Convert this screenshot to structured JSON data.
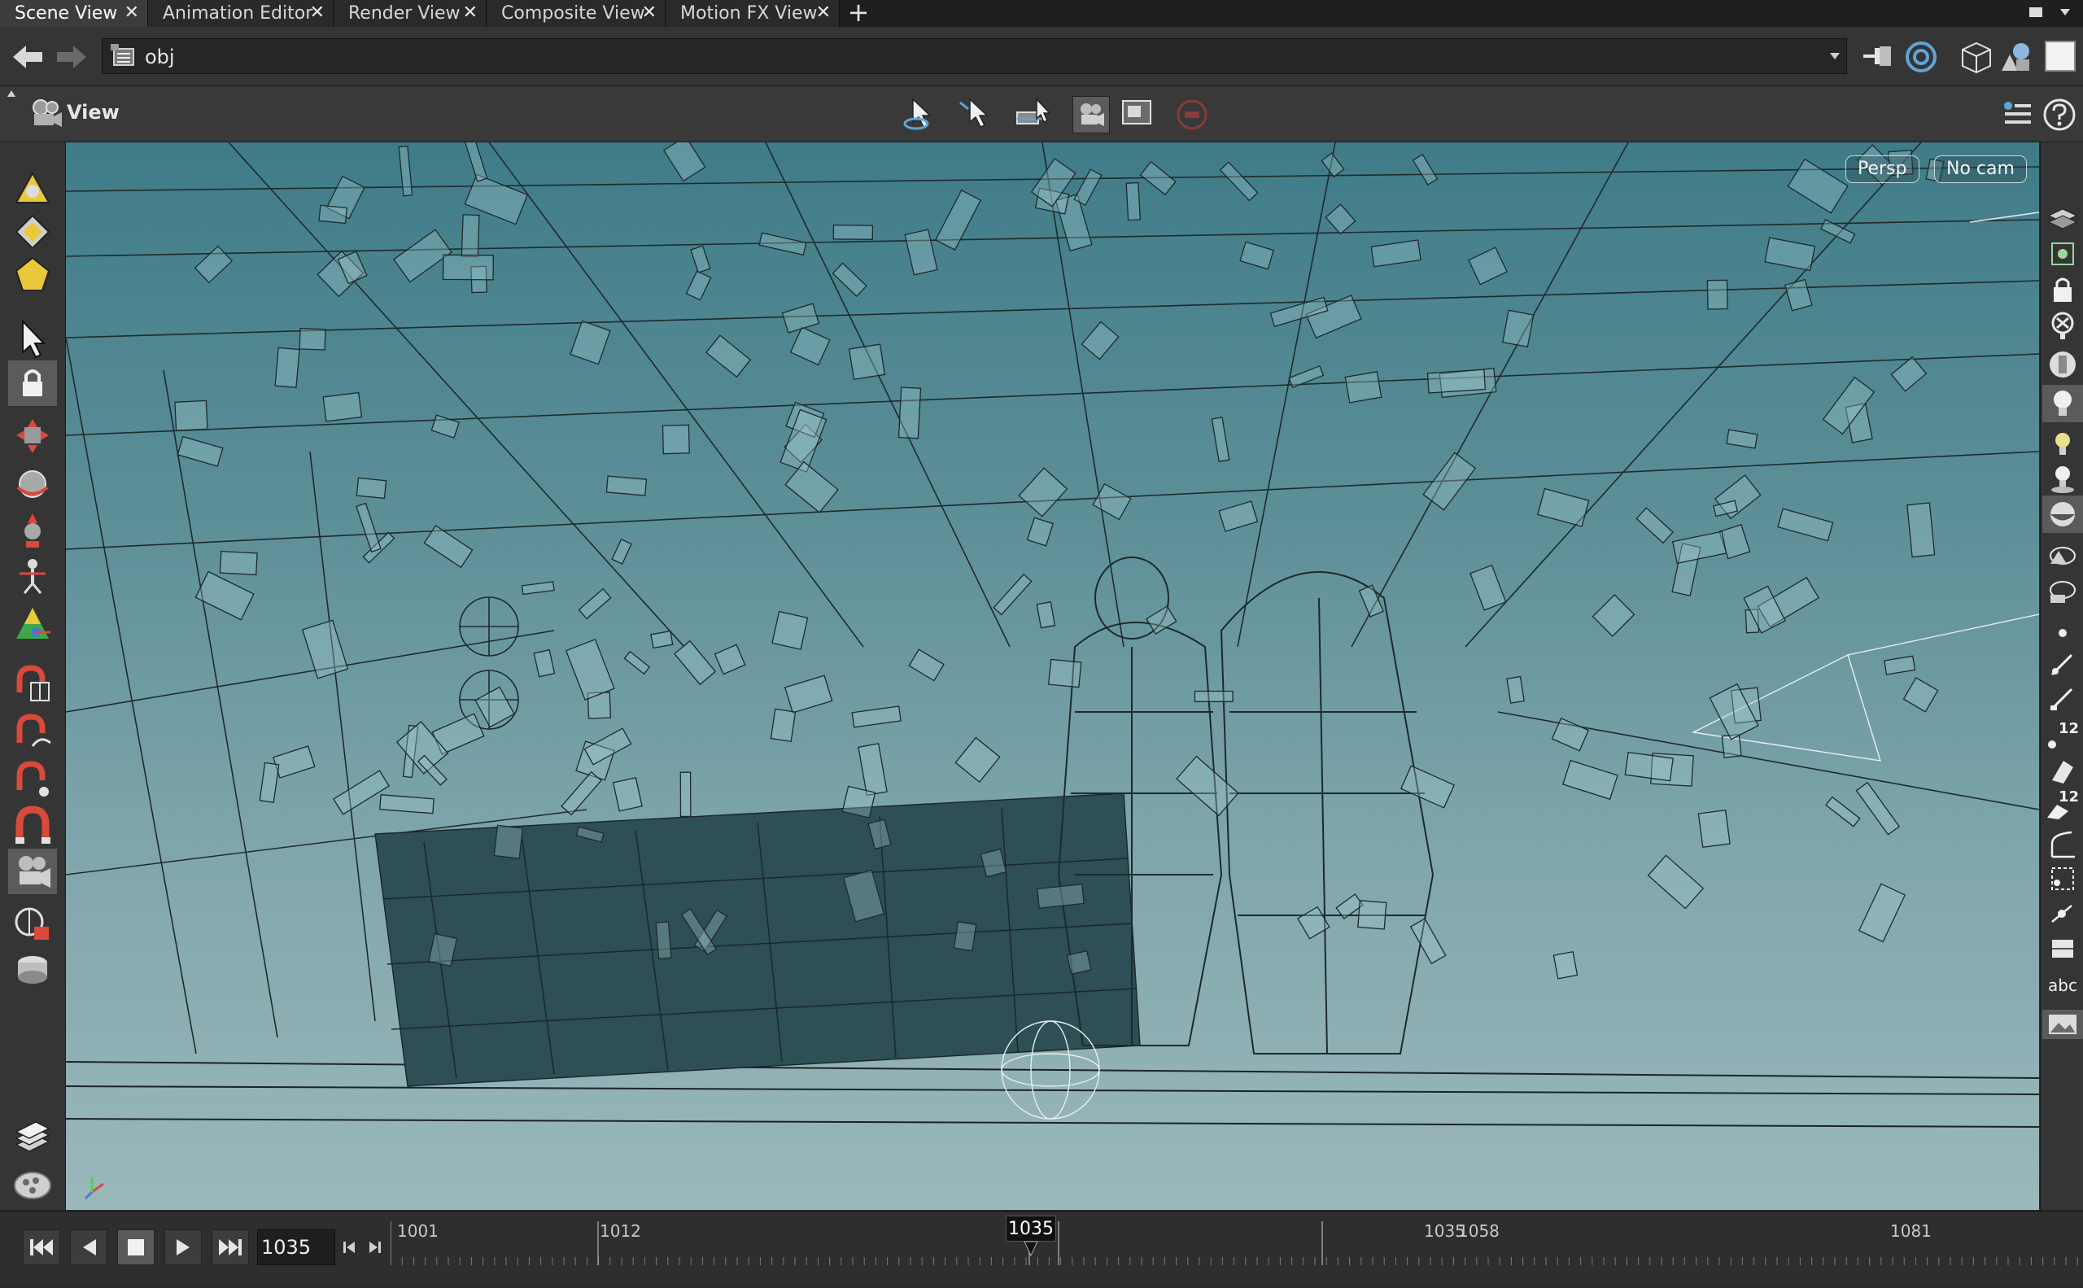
{
  "tabs": [
    {
      "label": "Scene View",
      "active": true
    },
    {
      "label": "Animation Editor",
      "active": false
    },
    {
      "label": "Render View",
      "active": false
    },
    {
      "label": "Composite View",
      "active": false
    },
    {
      "label": "Motion FX View",
      "active": false
    }
  ],
  "tab_close_glyph": "✕",
  "tab_add_glyph": "+",
  "path": {
    "value": "obj"
  },
  "viewer": {
    "title": "View"
  },
  "viewport": {
    "projection": "Persp",
    "camera": "No cam"
  },
  "right_toolbar": {
    "label_12a": "12",
    "label_12b": "12",
    "label_abc": "abc"
  },
  "timeline": {
    "current_frame": "1035",
    "current_frame_marker": "1035",
    "ticks": [
      "1001",
      "1012",
      "1035",
      "1058",
      "1081"
    ]
  },
  "colors": {
    "viewport_top": "#3f7c88",
    "viewport_bottom": "#9bb8bb",
    "wire": "#1e2a2c",
    "ui_bg": "#353535"
  }
}
